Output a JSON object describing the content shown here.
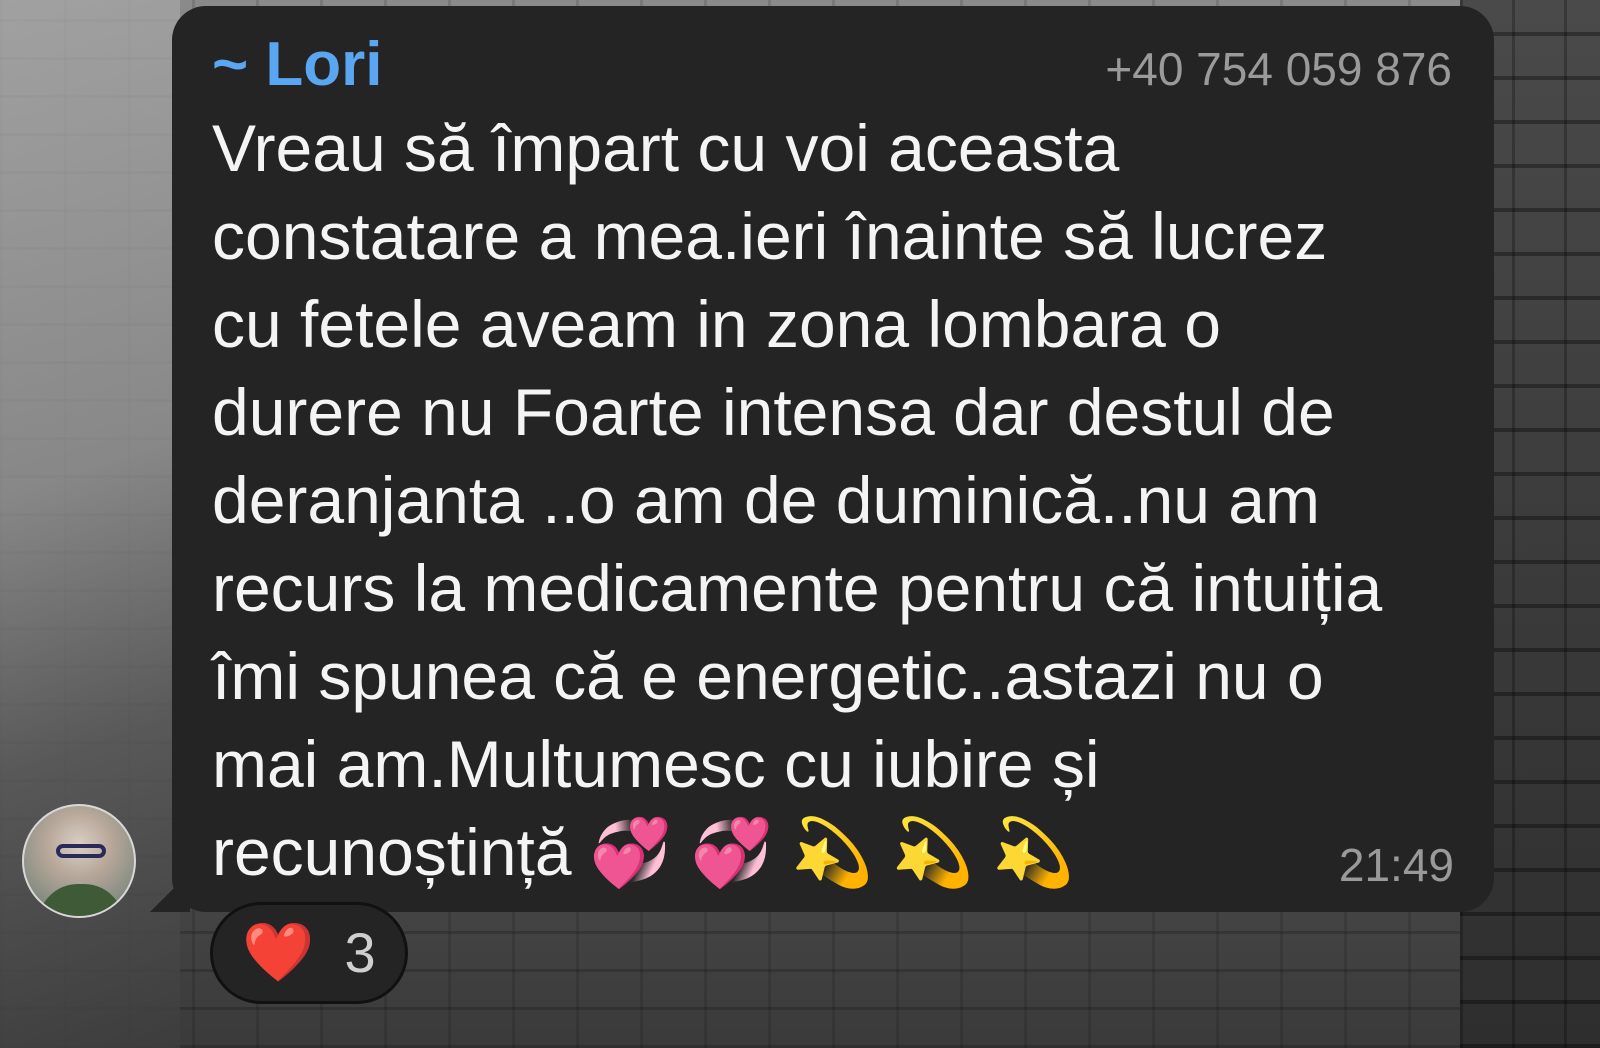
{
  "chat": {
    "sender_name": "~ Lori",
    "sender_phone": "+40 754 059 876",
    "message_lines": [
      "Vreau să împart cu voi aceasta",
      "constatare a mea.ieri înainte să lucrez",
      "cu fetele aveam in zona lombara o",
      "durere nu Foarte intensa dar destul de",
      "deranjanta ..o am de duminică..nu am",
      "recurs la medicamente pentru că intuiția",
      "îmi spunea că e energetic..astazi nu o",
      "mai am.Multumesc cu iubire și",
      "recunoștință"
    ],
    "message_emojis": [
      "💞",
      "💞",
      "💫",
      "💫",
      "💫"
    ],
    "time": "21:49",
    "reaction": {
      "emoji": "❤️",
      "count": "3"
    }
  },
  "colors": {
    "bubble_bg": "#242424",
    "sender_name": "#5aa6f0",
    "meta_text": "#9a9a9a",
    "message_text": "#f4f4f4"
  },
  "icons": {
    "reaction": "heart-icon"
  }
}
